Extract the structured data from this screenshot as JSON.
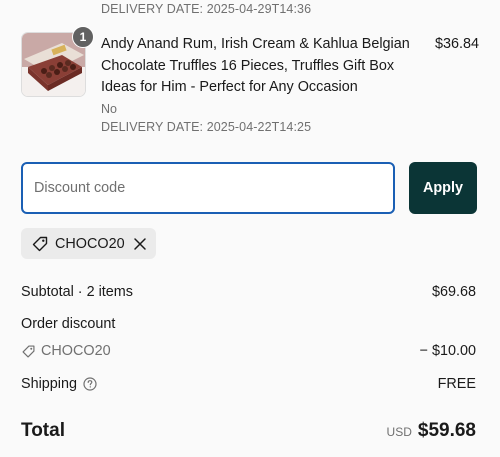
{
  "previous_item": {
    "delivery_date": "DELIVERY DATE: 2025-04-29T14:36"
  },
  "line_item": {
    "quantity": "1",
    "title": "Andy Anand Rum, Irish Cream & Kahlua Belgian Chocolate Truffles 16 Pieces, Truffles Gift Box Ideas for Him - Perfect for Any Occasion",
    "option": "No",
    "delivery_date": "DELIVERY DATE: 2025-04-22T14:25",
    "price": "$36.84",
    "thumbnail_icon": "chocolate-box-image"
  },
  "discount": {
    "placeholder": "Discount code",
    "value": "",
    "apply_label": "Apply",
    "applied_code": "CHOCO20",
    "tag_icon": "tag-icon",
    "remove_icon": "close-icon"
  },
  "summary": {
    "subtotal_label": "Subtotal · 2 items",
    "subtotal_value": "$69.68",
    "order_discount_label": "Order discount",
    "discount_code": "CHOCO20",
    "discount_value": "− $10.00",
    "shipping_label": "Shipping",
    "shipping_help_icon": "help-circle-icon",
    "shipping_value": "FREE",
    "total_label": "Total",
    "total_currency": "USD",
    "total_value": "$59.68"
  },
  "colors": {
    "accent_border": "#1a5fb4",
    "apply_button_bg": "#0b3536",
    "chip_bg": "#ebebeb",
    "muted_text": "#707070"
  }
}
